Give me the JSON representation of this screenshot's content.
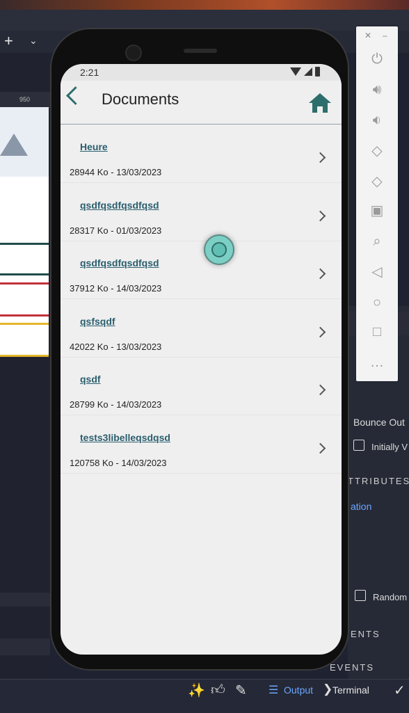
{
  "ide": {
    "ruler_label": "950",
    "right_panel": {
      "bounce_label": "Bounce Out",
      "initially_label": "Initially V",
      "attributes_label": "TTRIBUTES",
      "animation_link": "ation",
      "random_label": "Random",
      "events_label": "ENTS",
      "events_label2": "EVENTS"
    },
    "bottom": {
      "output_label": "Output",
      "terminal_label": "Terminal"
    }
  },
  "emulator_toolbar": {
    "items": [
      "power-icon",
      "volume-up-icon",
      "volume-down-icon",
      "rotate-left-icon",
      "rotate-right-icon",
      "camera-icon",
      "zoom-icon",
      "back-icon",
      "home-icon",
      "overview-icon",
      "more-icon"
    ]
  },
  "phone": {
    "status_time": "2:21",
    "appbar_title": "Documents",
    "documents": [
      {
        "name": "Heure",
        "meta": "28944 Ko - 13/03/2023"
      },
      {
        "name": "qsdfqsdfqsdfqsd",
        "meta": "28317 Ko - 01/03/2023"
      },
      {
        "name": "qsdfqsdfqsdfqsd",
        "meta": "37912 Ko - 14/03/2023"
      },
      {
        "name": "qsfsqdf",
        "meta": "42022 Ko - 13/03/2023"
      },
      {
        "name": "qsdf",
        "meta": "28799 Ko - 14/03/2023"
      },
      {
        "name": "tests3libelleqsdqsd",
        "meta": "120758 Ko - 14/03/2023"
      }
    ]
  },
  "colors": {
    "accent": "#2d6e6c",
    "link": "#2a5e6e"
  }
}
